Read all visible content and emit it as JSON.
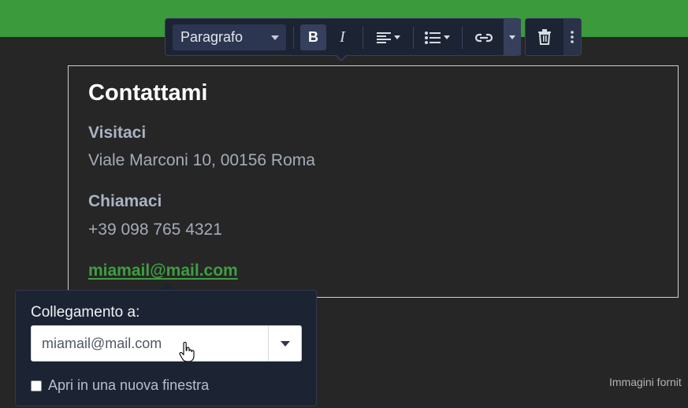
{
  "toolbar": {
    "style_select": "Paragrafo",
    "bold": "B",
    "italic": "I"
  },
  "content": {
    "title": "Contattami",
    "visit_heading": "Visitaci",
    "address": "Viale Marconi 10, 00156 Roma",
    "call_heading": "Chiamaci",
    "phone": "+39 098 765 4321",
    "email": "miamail@mail.com"
  },
  "link_popover": {
    "label": "Collegamento a:",
    "url_value": "miamail@mail.com",
    "new_window_label": "Apri in una nuova finestra",
    "new_window_checked": false
  },
  "footer": {
    "credit": "Immagini fornit"
  },
  "colors": {
    "accent_green": "#3a9a3c",
    "toolbar_bg": "#1c2333",
    "page_bg": "#262626"
  }
}
